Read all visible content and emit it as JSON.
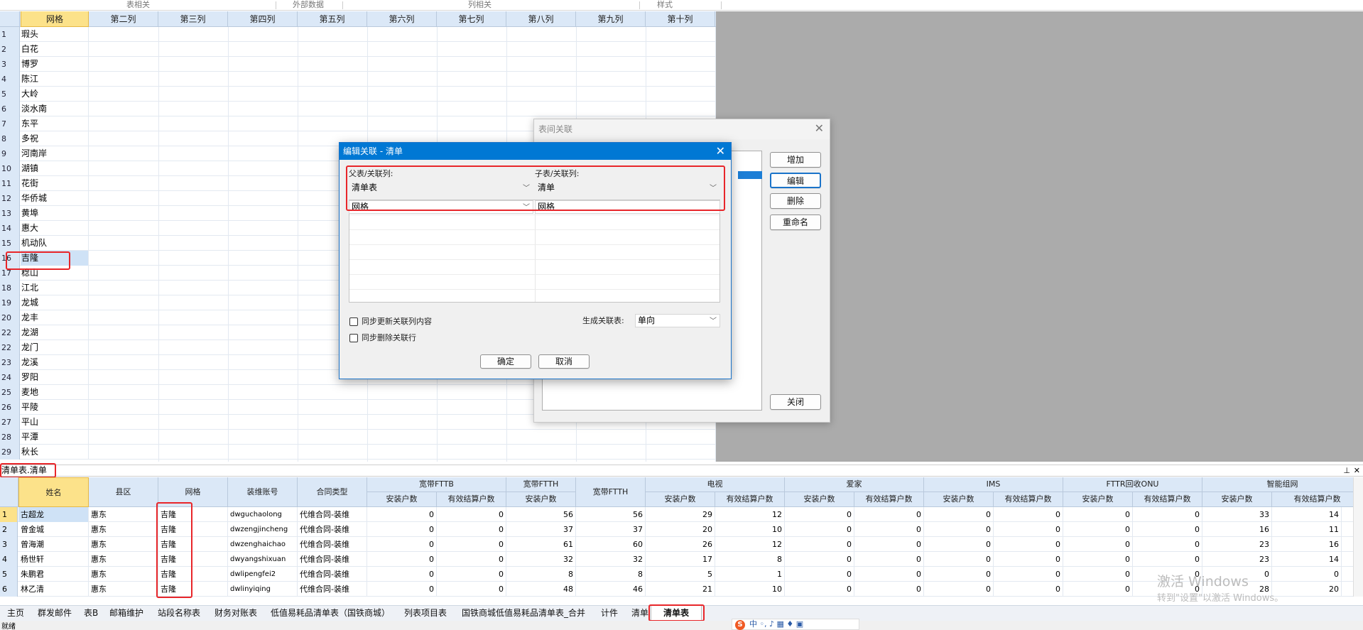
{
  "ribbon_groups": [
    "表相关",
    "外部数据",
    "列相关",
    "样式"
  ],
  "top_grid": {
    "columns": [
      "网格",
      "第二列",
      "第三列",
      "第四列",
      "第五列",
      "第六列",
      "第七列",
      "第八列",
      "第九列",
      "第十列"
    ],
    "rows": [
      {
        "num": "1",
        "value": "瑕头"
      },
      {
        "num": "2",
        "value": "白花"
      },
      {
        "num": "3",
        "value": "博罗"
      },
      {
        "num": "4",
        "value": "陈江"
      },
      {
        "num": "5",
        "value": "大岭"
      },
      {
        "num": "6",
        "value": "淡水南"
      },
      {
        "num": "7",
        "value": "东平"
      },
      {
        "num": "8",
        "value": "多祝"
      },
      {
        "num": "9",
        "value": "河南岸"
      },
      {
        "num": "10",
        "value": "湖镇"
      },
      {
        "num": "11",
        "value": "花街"
      },
      {
        "num": "12",
        "value": "华侨城"
      },
      {
        "num": "13",
        "value": "黄埠"
      },
      {
        "num": "14",
        "value": "惠大"
      },
      {
        "num": "15",
        "value": "机动队"
      },
      {
        "num": "16",
        "value": "吉隆"
      },
      {
        "num": "17",
        "value": "稔山"
      },
      {
        "num": "18",
        "value": "江北"
      },
      {
        "num": "19",
        "value": "龙城"
      },
      {
        "num": "20",
        "value": "龙丰"
      },
      {
        "num": "22",
        "value": "龙湖"
      },
      {
        "num": "22",
        "value": "龙门"
      },
      {
        "num": "23",
        "value": "龙溪"
      },
      {
        "num": "24",
        "value": "罗阳"
      },
      {
        "num": "25",
        "value": "麦地"
      },
      {
        "num": "26",
        "value": "平陵"
      },
      {
        "num": "27",
        "value": "平山"
      },
      {
        "num": "28",
        "value": "平潭"
      },
      {
        "num": "29",
        "value": "秋长"
      }
    ]
  },
  "relation_dialog": {
    "title": "表间关联",
    "buttons": {
      "add": "增加",
      "edit": "编辑",
      "delete": "删除",
      "rename": "重命名",
      "close": "关闭"
    }
  },
  "edit_dialog": {
    "title": "编辑关联 - 清单",
    "parent_label": "父表/关联列:",
    "child_label": "子表/关联列:",
    "parent_table": "清单表",
    "child_table": "清单",
    "parent_column": "网格",
    "child_column": "网格",
    "sync_update": "同步更新关联列内容",
    "sync_delete": "同步删除关联行",
    "gen_label": "生成关联表:",
    "gen_value": "单向",
    "ok": "确定",
    "cancel": "取消"
  },
  "bottom_label": "清单表.清单",
  "bottom_grid": {
    "single_headers": [
      "姓名",
      "县区",
      "网格",
      "装维账号",
      "合同类型"
    ],
    "group_headers": [
      "宽带FTTB",
      "宽带FTTH",
      "宽带FTTH",
      "电视",
      "爱家",
      "IMS",
      "FTTR回收ONU",
      "智能组网"
    ],
    "sub_headers": [
      "安装户数",
      "有效结算户数",
      "安装户数",
      "安装户数",
      "有效结算户数",
      "安装户数",
      "有效结算户数",
      "安装户数",
      "有效结算户数",
      "安装户数",
      "有效结算户数",
      "安装户数",
      "有效结算户数"
    ],
    "rows": [
      {
        "num": "1",
        "name": "古超龙",
        "county": "惠东",
        "grid": "吉隆",
        "account": "dwguchaolong",
        "contract": "代维合同-装维",
        "v": [
          "0",
          "0",
          "56",
          "56",
          "29",
          "12",
          "0",
          "0",
          "0",
          "0",
          "0",
          "0",
          "33",
          "14"
        ]
      },
      {
        "num": "2",
        "name": "曾金城",
        "county": "惠东",
        "grid": "吉隆",
        "account": "dwzengjincheng",
        "contract": "代维合同-装维",
        "v": [
          "0",
          "0",
          "37",
          "37",
          "20",
          "10",
          "0",
          "0",
          "0",
          "0",
          "0",
          "0",
          "16",
          "11"
        ]
      },
      {
        "num": "3",
        "name": "曾海潮",
        "county": "惠东",
        "grid": "吉隆",
        "account": "dwzenghaichao",
        "contract": "代维合同-装维",
        "v": [
          "0",
          "0",
          "61",
          "60",
          "26",
          "12",
          "0",
          "0",
          "0",
          "0",
          "0",
          "0",
          "23",
          "16"
        ]
      },
      {
        "num": "4",
        "name": "杨世轩",
        "county": "惠东",
        "grid": "吉隆",
        "account": "dwyangshixuan",
        "contract": "代维合同-装维",
        "v": [
          "0",
          "0",
          "32",
          "32",
          "17",
          "8",
          "0",
          "0",
          "0",
          "0",
          "0",
          "0",
          "23",
          "14"
        ]
      },
      {
        "num": "5",
        "name": "朱鹏君",
        "county": "惠东",
        "grid": "吉隆",
        "account": "dwlipengfei2",
        "contract": "代维合同-装维",
        "v": [
          "0",
          "0",
          "8",
          "8",
          "5",
          "1",
          "0",
          "0",
          "0",
          "0",
          "0",
          "0",
          "0",
          "0"
        ]
      },
      {
        "num": "6",
        "name": "林乙清",
        "county": "惠东",
        "grid": "吉隆",
        "account": "dwlinyiqing",
        "contract": "代维合同-装维",
        "v": [
          "0",
          "0",
          "48",
          "46",
          "21",
          "10",
          "0",
          "0",
          "0",
          "0",
          "0",
          "0",
          "28",
          "20"
        ]
      }
    ]
  },
  "sheet_tabs": [
    "主页",
    "群发邮件",
    "表B",
    "邮箱维护",
    "站段名称表",
    "财务对账表",
    "低值易耗品清单表（国铁商城）",
    "列表项目表",
    "国铁商城低值易耗品清单表_合并",
    "计件",
    "清单",
    "清单表"
  ],
  "status_text": "就绪",
  "watermark": {
    "line1": "激活 Windows",
    "line2": "转到\"设置\"以激活 Windows。"
  },
  "ime": {
    "logo": "S",
    "text": "中 ◦, ♪ ▦ ♦ ▣"
  },
  "colors": {
    "accent": "#0078d4",
    "highlight": "#e8262a",
    "header": "#dbe8f7",
    "selected_header": "#fce28a"
  }
}
